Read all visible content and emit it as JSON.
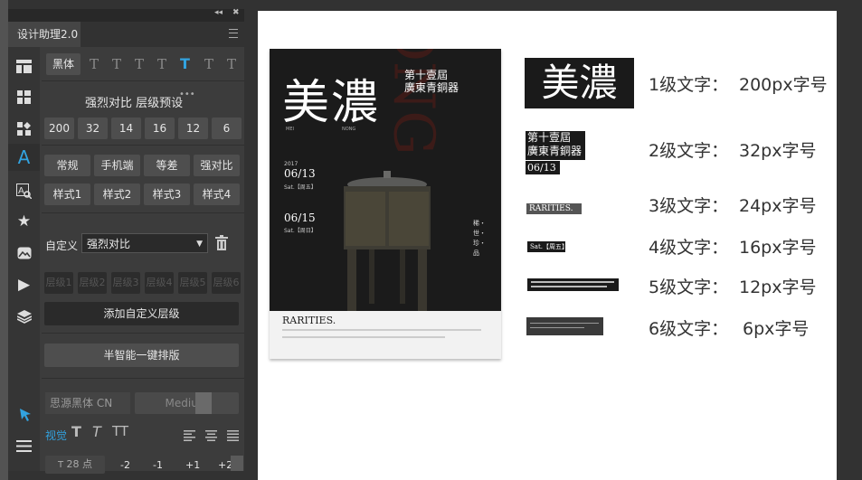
{
  "panel": {
    "title": "设计助理2.0",
    "collapse_glyph": "◂◂",
    "close_glyph": "✖",
    "font_family_btn": "黑体",
    "contrast_label": "强烈对比 层级预设",
    "more_glyph": "•••",
    "sizes": [
      "200",
      "32",
      "14",
      "16",
      "12",
      "6"
    ],
    "styles_row1": [
      "常规",
      "手机端",
      "等差",
      "强对比"
    ],
    "styles_row2": [
      "样式1",
      "样式2",
      "样式3",
      "样式4"
    ],
    "custom_label": "自定义",
    "custom_select": "强烈对比",
    "levels": [
      "层级1",
      "层级2",
      "层级3",
      "层级4",
      "层级5",
      "层级6"
    ],
    "add_level": "添加自定义层级",
    "smart_layout": "半智能一键排版",
    "font_name": "思源黑体 CN",
    "font_weight": "Medium",
    "vision_label": "视觉",
    "size_value": "28",
    "size_unit": "点",
    "steps": [
      "-2",
      "-1",
      "+1",
      "+2"
    ],
    "accent": "#32a3e0"
  },
  "rail_icons": [
    "layout-icon",
    "grid-icon",
    "widgets-icon",
    "text-icon",
    "text-search-icon",
    "star-icon",
    "image-icon",
    "play-icon",
    "layers-icon",
    "pin-icon",
    "menu-icon"
  ],
  "poster": {
    "big": "美濃",
    "sub1": "第十壹屆",
    "sub2": "廣東青銅器",
    "mei": "MEI",
    "nong": "NONG",
    "year": "2017",
    "d1": "06/13",
    "sat1": "Sat.【周五】",
    "d2": "06/15",
    "sat2": "Sat.【周日】",
    "rarities": "RARITIES.",
    "vert": "稀・世・珍・品",
    "bg_word": "MEI NONG"
  },
  "samples": {
    "s1": "美濃",
    "s2a": "第十壹屆",
    "s2b": "廣東青銅器",
    "s2c": "06/13",
    "s3": "RARITIES.",
    "s4": "Sat.【周五】"
  },
  "levels_text": [
    {
      "label": "1级文字：",
      "size": "200px字号"
    },
    {
      "label": "2级文字：",
      "size": "32px字号"
    },
    {
      "label": "3级文字：",
      "size": "24px字号"
    },
    {
      "label": "4级文字：",
      "size": "16px字号"
    },
    {
      "label": "5级文字：",
      "size": "12px字号"
    },
    {
      "label": "6级文字：",
      "size": "6px字号"
    }
  ]
}
